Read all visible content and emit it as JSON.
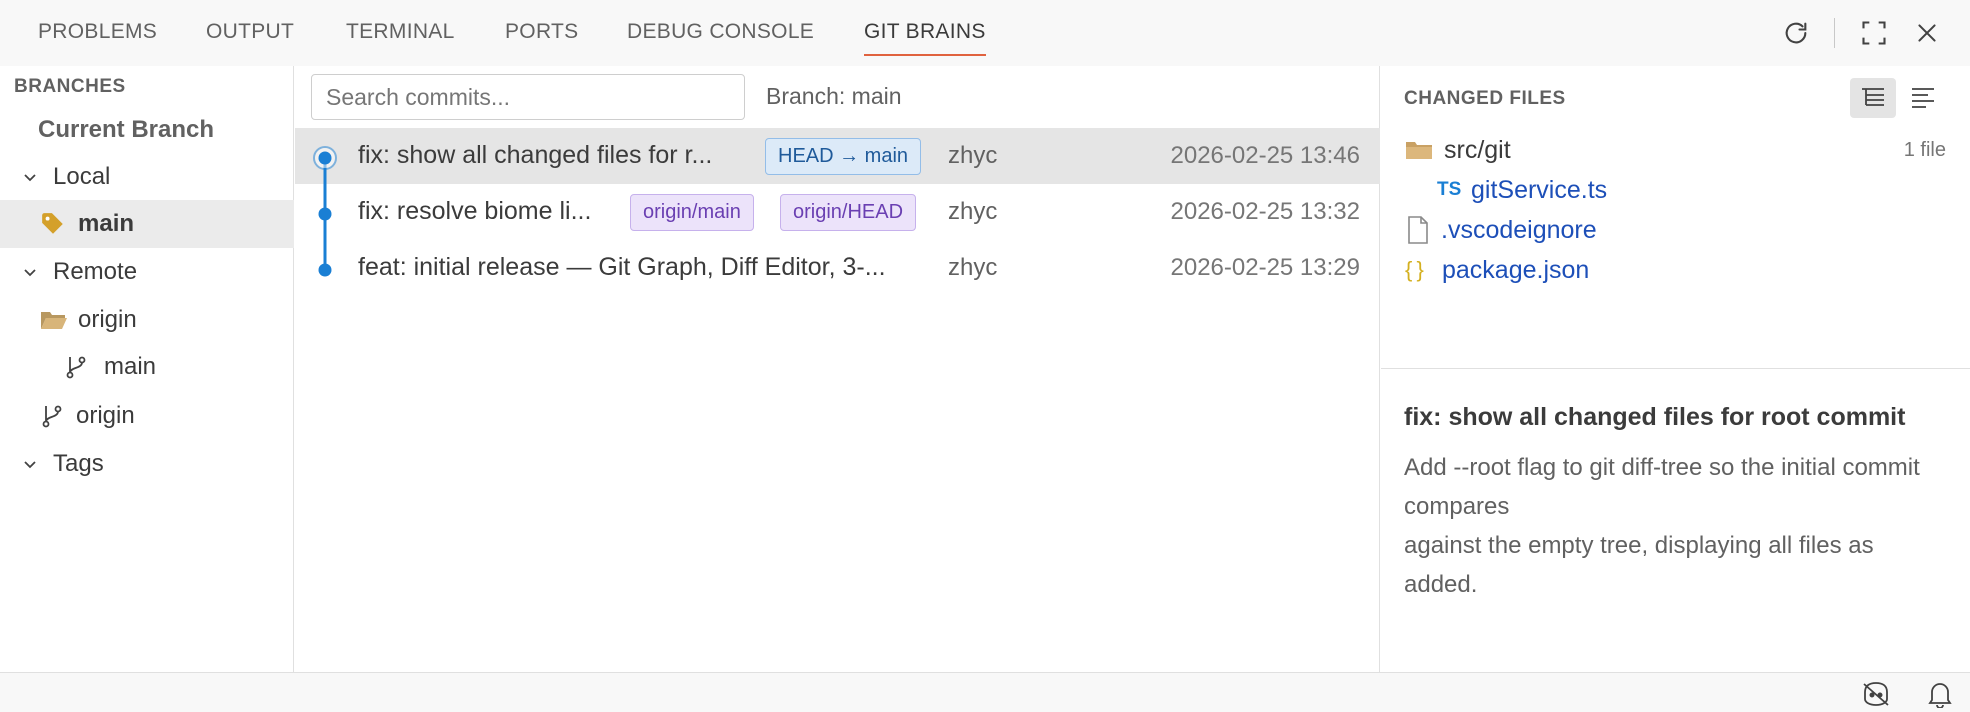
{
  "panel_tabs": [
    {
      "label": "PROBLEMS"
    },
    {
      "label": "OUTPUT"
    },
    {
      "label": "TERMINAL"
    },
    {
      "label": "PORTS"
    },
    {
      "label": "DEBUG CONSOLE"
    },
    {
      "label": "GIT BRAINS",
      "active": true
    }
  ],
  "toolbar_icons": [
    "refresh-icon",
    "maximize-icon",
    "close-icon"
  ],
  "branches": {
    "title": "BRANCHES",
    "current_branch_label": "Current Branch",
    "local_label": "Local",
    "local_items": [
      {
        "name": "main",
        "icon": "tag-icon",
        "selected": true
      }
    ],
    "remote_label": "Remote",
    "remote_groups": [
      {
        "name": "origin",
        "icon": "folder-open-icon",
        "children": [
          {
            "name": "main",
            "icon": "git-branch-icon"
          }
        ]
      }
    ],
    "remote_items": [
      {
        "name": "origin",
        "icon": "git-branch-icon"
      }
    ],
    "tags_label": "Tags"
  },
  "commit_list": {
    "search_placeholder": "Search commits...",
    "branch_label": "Branch: main",
    "commits": [
      {
        "message": "fix: show all changed files for r...",
        "refs": [
          "HEAD → main"
        ],
        "author": "zhyc",
        "date": "2026-02-25 13:46",
        "selected": true
      },
      {
        "message": "fix: resolve biome li...",
        "refs": [
          "origin/main",
          "origin/HEAD"
        ],
        "author": "zhyc",
        "date": "2026-02-25 13:32"
      },
      {
        "message": "feat: initial release — Git Graph, Diff Editor, 3-...",
        "refs": [],
        "author": "zhyc",
        "date": "2026-02-25 13:29"
      }
    ]
  },
  "changed_files": {
    "title": "CHANGED FILES",
    "view_icons": [
      "tree-view-icon",
      "list-view-icon"
    ],
    "folder": {
      "name": "src/git",
      "count": "1 file",
      "icon": "folder-icon"
    },
    "files": [
      {
        "name": "gitService.ts",
        "icon_text": "TS"
      },
      {
        "name": ".vscodeignore",
        "icon": "file-icon"
      },
      {
        "name": "package.json",
        "icon_text": "{ }"
      }
    ]
  },
  "commit_details": {
    "title": "fix: show all changed files for root commit",
    "body_line1": "Add --root flag to git diff-tree so the initial commit compares",
    "body_line2": "against the empty tree, displaying all files as added."
  },
  "status_bar_icons": [
    "copilot-icon",
    "bell-icon"
  ],
  "colors": {
    "accent_tab": "#e0623f",
    "graph_line": "#1a7fd4",
    "head_badge_bg": "#dceaf8",
    "origin_badge_bg": "#ece3fa",
    "tag_icon": "#d4a02a",
    "file_link": "#1d4fb8"
  }
}
